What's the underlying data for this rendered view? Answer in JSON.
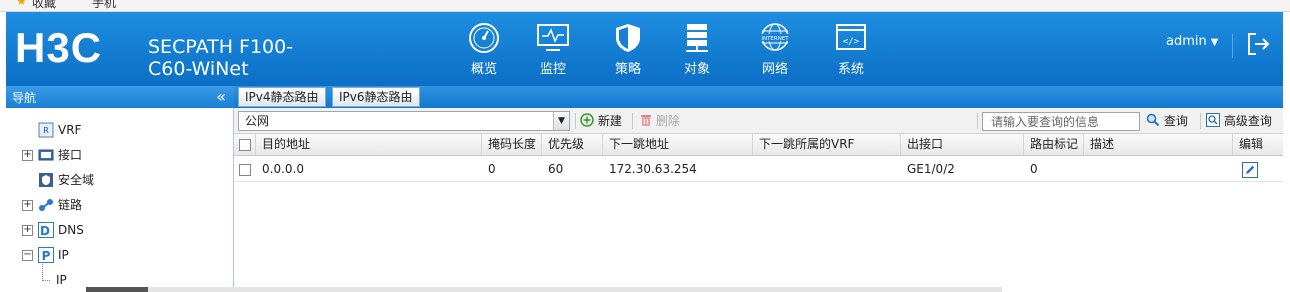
{
  "browser": {
    "bookmark_star": "★",
    "bookmark_1": "收藏",
    "bookmark_2": "手机"
  },
  "header": {
    "logo": "H3C",
    "product_line1": "SECPATH F100-",
    "product_line2": "C60-WiNet",
    "nav": [
      {
        "label": "概览",
        "icon": "gauge-icon"
      },
      {
        "label": "监控",
        "icon": "monitor-icon"
      },
      {
        "label": "策略",
        "icon": "shield-icon"
      },
      {
        "label": "对象",
        "icon": "server-icon"
      },
      {
        "label": "网络",
        "icon": "globe-icon",
        "icon_text": "INTERNET"
      },
      {
        "label": "系统",
        "icon": "code-window-icon",
        "icon_text": "</>"
      }
    ],
    "user": "admin",
    "user_caret": "▼",
    "colors": {
      "header_bg": "#1583d9",
      "nav_bar_bg": "#1e88d8"
    }
  },
  "sidebar": {
    "title": "导航",
    "collapse_glyph": "«",
    "items": [
      {
        "label": "VRF",
        "icon": "vrf-icon",
        "expander": ""
      },
      {
        "label": "接口",
        "icon": "interface-icon",
        "expander": "+"
      },
      {
        "label": "安全域",
        "icon": "security-zone-icon",
        "expander": ""
      },
      {
        "label": "链路",
        "icon": "link-icon",
        "expander": "+"
      },
      {
        "label": "DNS",
        "icon": "dns-icon",
        "expander": "+"
      },
      {
        "label": "IP",
        "icon": "ip-icon",
        "expander": "−"
      },
      {
        "label": "IP",
        "icon": "",
        "expander": ""
      }
    ]
  },
  "tabs": [
    {
      "label": "IPv4静态路由",
      "active": true
    },
    {
      "label": "IPv6静态路由",
      "active": false
    }
  ],
  "toolbar": {
    "vrf_value": "公网",
    "new_label": "新建",
    "delete_label": "删除",
    "search_placeholder": "请输入要查询的信息",
    "query_label": "查询",
    "advanced_query_label": "高级查询"
  },
  "table": {
    "columns": [
      "目的地址",
      "掩码长度",
      "优先级",
      "下一跳地址",
      "下一跳所属的VRF",
      "出接口",
      "路由标记",
      "描述",
      "编辑"
    ],
    "rows": [
      {
        "dest": "0.0.0.0",
        "mask": "0",
        "priority": "60",
        "nexthop": "172.30.63.254",
        "nexthop_vrf": "",
        "iface": "GE1/0/2",
        "tag": "0",
        "desc": ""
      }
    ]
  }
}
